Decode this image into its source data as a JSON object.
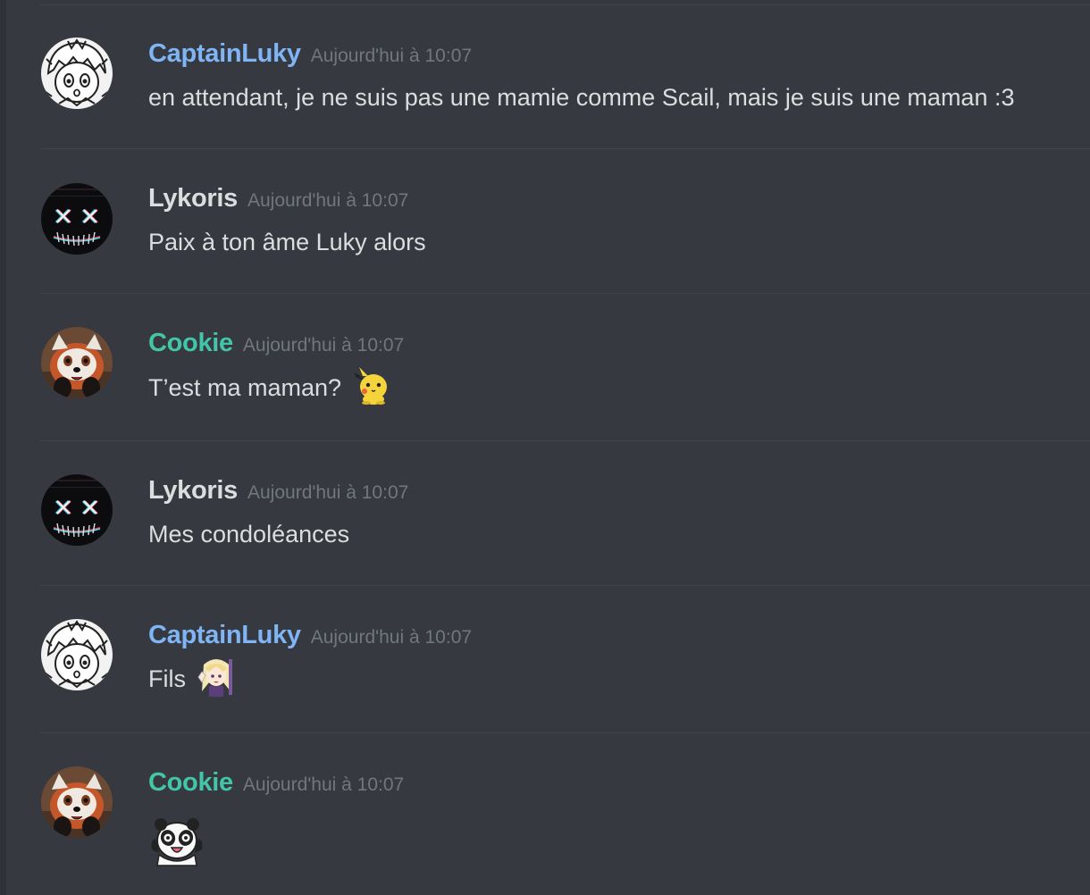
{
  "colors": {
    "background": "#36393f",
    "divider": "#40444b",
    "timestamp": "#72767d",
    "message_text": "#dcddde",
    "captainluky": "#7fb4f5",
    "lykoris": "#dcddde",
    "cookie": "#43c6a7"
  },
  "messages": [
    {
      "username": "CaptainLuky",
      "timestamp": "Aujourd'hui à 10:07",
      "text": "en attendant, je ne suis pas une mamie comme Scail, mais je suis une maman :3",
      "avatar": "manga-boy-avatar"
    },
    {
      "username": "Lykoris",
      "timestamp": "Aujourd'hui à 10:07",
      "text": "Paix à ton âme Luky alors",
      "avatar": "neon-mask-avatar"
    },
    {
      "username": "Cookie",
      "timestamp": "Aujourd'hui à 10:07",
      "text": "T’est ma maman?",
      "avatar": "red-panda-avatar",
      "emoji": "pikachu-emoji"
    },
    {
      "username": "Lykoris",
      "timestamp": "Aujourd'hui à 10:07",
      "text": "Mes condoléances",
      "avatar": "neon-mask-avatar"
    },
    {
      "username": "CaptainLuky",
      "timestamp": "Aujourd'hui à 10:07",
      "text": "Fils",
      "avatar": "manga-boy-avatar",
      "emoji": "anime-girl-wave-emoji"
    },
    {
      "username": "Cookie",
      "timestamp": "Aujourd'hui à 10:07",
      "text": "",
      "avatar": "red-panda-avatar",
      "emoji": "panda-hands-up-emoji"
    }
  ]
}
